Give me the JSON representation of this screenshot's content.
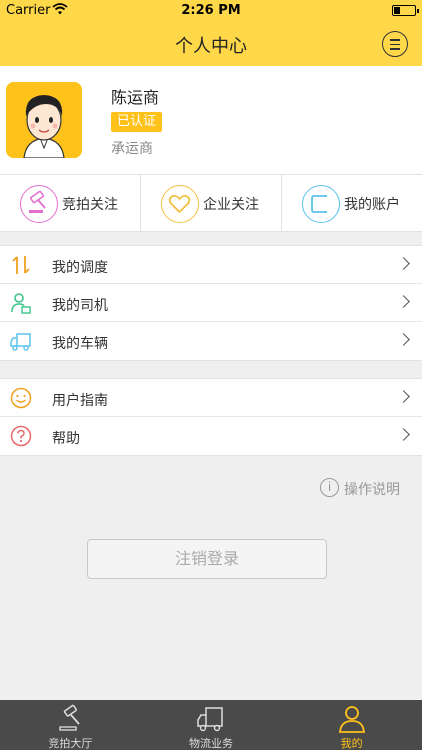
{
  "status_bar": {
    "carrier": "Carrier",
    "time": "2:26 PM"
  },
  "nav": {
    "title": "个人中心"
  },
  "profile": {
    "name": "陈运商",
    "badge": "已认证",
    "role": "承运商"
  },
  "quick_actions": [
    {
      "label": "竞拍关注",
      "icon": "gavel-icon",
      "color": "#e06fd0"
    },
    {
      "label": "企业关注",
      "icon": "heart-icon",
      "color": "#f0c040"
    },
    {
      "label": "我的账户",
      "icon": "wallet-icon",
      "color": "#5ac3ea"
    }
  ],
  "menu_group_1": [
    {
      "label": "我的调度",
      "icon": "dispatch-arrows-icon"
    },
    {
      "label": "我的司机",
      "icon": "driver-icon"
    },
    {
      "label": "我的车辆",
      "icon": "truck-icon"
    }
  ],
  "menu_group_2": [
    {
      "label": "用户指南",
      "icon": "smile-icon"
    },
    {
      "label": "帮助",
      "icon": "question-icon"
    }
  ],
  "help_link": {
    "icon_glyph": "i",
    "label": "操作说明"
  },
  "logout": {
    "label": "注销登录"
  },
  "tabs": [
    {
      "label": "竞拍大厅",
      "icon": "gavel-icon",
      "active": false
    },
    {
      "label": "物流业务",
      "icon": "truck-icon",
      "active": false
    },
    {
      "label": "我的",
      "icon": "person-icon",
      "active": true
    }
  ],
  "colors": {
    "accent": "#ffd84a",
    "badge": "#ffc21a",
    "tabbar": "#4a4a4a"
  }
}
